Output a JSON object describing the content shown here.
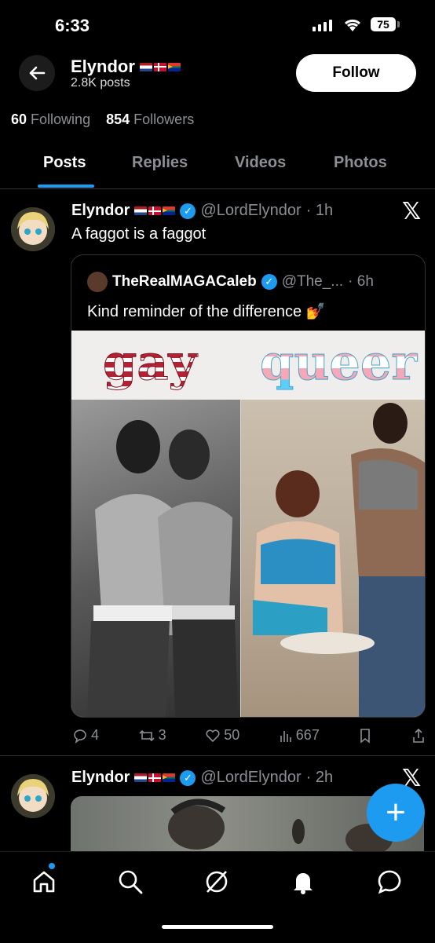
{
  "status_bar": {
    "time": "6:33",
    "battery": "75"
  },
  "header": {
    "name": "Elyndor",
    "posts_count": "2.8K posts",
    "follow_label": "Follow"
  },
  "profile": {
    "following_count": "60",
    "following_label": "Following",
    "followers_count": "854",
    "followers_label": "Followers"
  },
  "tabs": [
    {
      "label": "Posts",
      "active": true
    },
    {
      "label": "Replies",
      "active": false
    },
    {
      "label": "Videos",
      "active": false
    },
    {
      "label": "Photos",
      "active": false
    }
  ],
  "posts": [
    {
      "name": "Elyndor",
      "handle": "@LordElyndor",
      "time": "· 1h",
      "text": "A faggot is a faggot",
      "quote": {
        "name": "TheRealMAGACaleb",
        "handle": "@The_...",
        "time": "· 6h",
        "text": "Kind reminder of the difference 💅",
        "image_left_word": "gay",
        "image_right_word": "queer"
      },
      "stats": {
        "replies": "4",
        "reposts": "3",
        "likes": "50",
        "views": "667"
      }
    },
    {
      "name": "Elyndor",
      "handle": "@LordElyndor",
      "time": "· 2h"
    }
  ],
  "colors": {
    "accent": "#1d9bf0",
    "background": "#000000",
    "muted": "#8b8f94"
  }
}
